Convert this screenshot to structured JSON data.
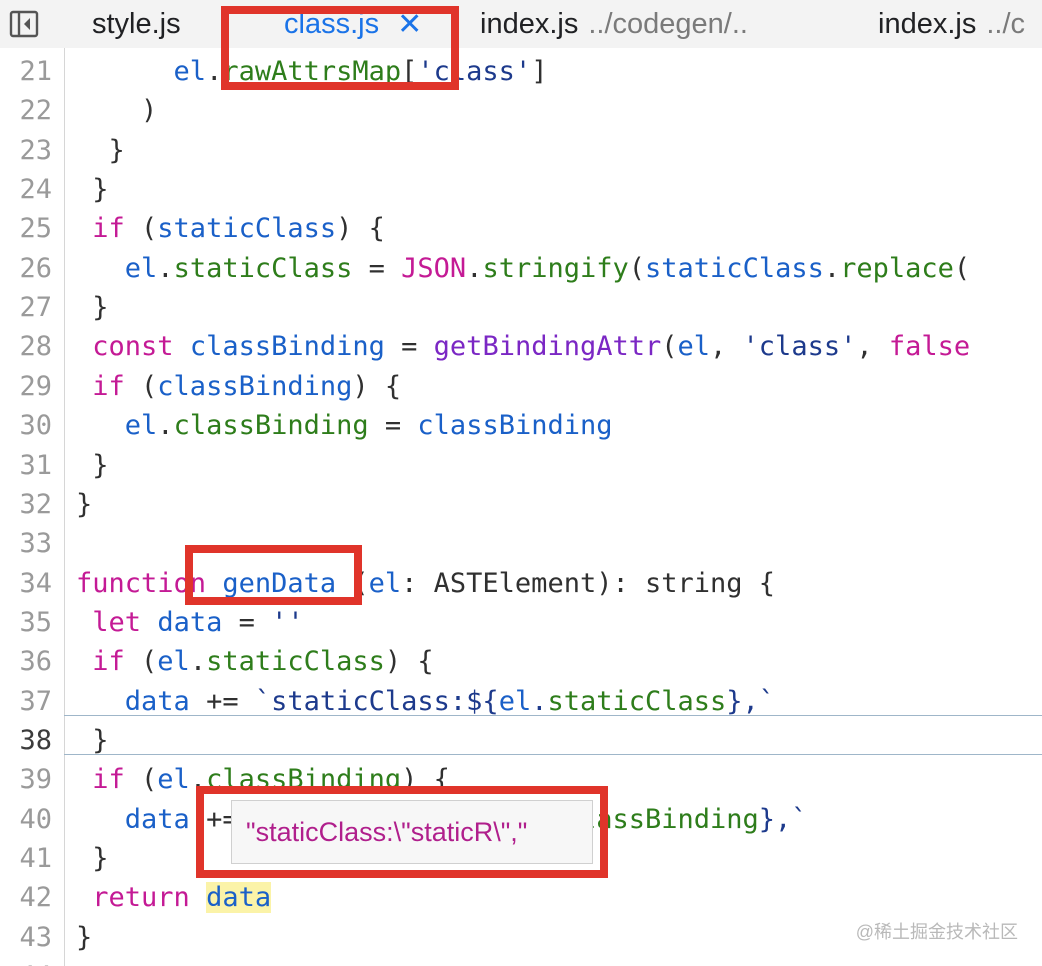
{
  "tabs": [
    {
      "name": "style.js",
      "hint": ""
    },
    {
      "name": "class.js",
      "hint": "",
      "close": "✕",
      "active": true
    },
    {
      "name": "index.js",
      "hint": "../codegen/.."
    },
    {
      "name": "index.js",
      "hint": "../c"
    }
  ],
  "lines": [
    {
      "n": "21",
      "tokens": [
        [
          "t",
          "      "
        ],
        [
          "v",
          "el"
        ],
        [
          "t",
          "."
        ],
        [
          "p",
          "rawAttrsMap"
        ],
        [
          "t",
          "["
        ],
        [
          "s",
          "'class'"
        ],
        [
          "t",
          "]"
        ]
      ]
    },
    {
      "n": "22",
      "tokens": [
        [
          "t",
          "    )"
        ]
      ]
    },
    {
      "n": "23",
      "tokens": [
        [
          "t",
          "  }"
        ]
      ]
    },
    {
      "n": "24",
      "tokens": [
        [
          "t",
          " }"
        ]
      ]
    },
    {
      "n": "25",
      "tokens": [
        [
          "t",
          " "
        ],
        [
          "k",
          "if"
        ],
        [
          "t",
          " ("
        ],
        [
          "v",
          "staticClass"
        ],
        [
          "t",
          ") {"
        ]
      ]
    },
    {
      "n": "26",
      "tokens": [
        [
          "t",
          "   "
        ],
        [
          "v",
          "el"
        ],
        [
          "t",
          "."
        ],
        [
          "p",
          "staticClass"
        ],
        [
          "t",
          " = "
        ],
        [
          "k",
          "JSON"
        ],
        [
          "t",
          "."
        ],
        [
          "p",
          "stringify"
        ],
        [
          "t",
          "("
        ],
        [
          "v",
          "staticClass"
        ],
        [
          "t",
          "."
        ],
        [
          "p",
          "replace"
        ],
        [
          "t",
          "("
        ]
      ]
    },
    {
      "n": "27",
      "tokens": [
        [
          "t",
          " }"
        ]
      ]
    },
    {
      "n": "28",
      "tokens": [
        [
          "t",
          " "
        ],
        [
          "k",
          "const"
        ],
        [
          "t",
          " "
        ],
        [
          "v",
          "classBinding"
        ],
        [
          "t",
          " = "
        ],
        [
          "f",
          "getBindingAttr"
        ],
        [
          "t",
          "("
        ],
        [
          "v",
          "el"
        ],
        [
          "t",
          ", "
        ],
        [
          "s",
          "'class'"
        ],
        [
          "t",
          ", "
        ],
        [
          "k",
          "false"
        ]
      ]
    },
    {
      "n": "29",
      "tokens": [
        [
          "t",
          " "
        ],
        [
          "k",
          "if"
        ],
        [
          "t",
          " ("
        ],
        [
          "v",
          "classBinding"
        ],
        [
          "t",
          ") {"
        ]
      ]
    },
    {
      "n": "30",
      "tokens": [
        [
          "t",
          "   "
        ],
        [
          "v",
          "el"
        ],
        [
          "t",
          "."
        ],
        [
          "p",
          "classBinding"
        ],
        [
          "t",
          " = "
        ],
        [
          "v",
          "classBinding"
        ]
      ]
    },
    {
      "n": "31",
      "tokens": [
        [
          "t",
          " }"
        ]
      ]
    },
    {
      "n": "32",
      "tokens": [
        [
          "t",
          "}"
        ]
      ]
    },
    {
      "n": "33",
      "tokens": []
    },
    {
      "n": "34",
      "tokens": [
        [
          "k",
          "function"
        ],
        [
          "t",
          " "
        ],
        [
          "v",
          "genData"
        ],
        [
          "t",
          " ("
        ],
        [
          "v",
          "el"
        ],
        [
          "t",
          ": ASTElement): string {"
        ]
      ]
    },
    {
      "n": "35",
      "tokens": [
        [
          "t",
          " "
        ],
        [
          "k",
          "let"
        ],
        [
          "t",
          " "
        ],
        [
          "v",
          "data"
        ],
        [
          "t",
          " = "
        ],
        [
          "s",
          "''"
        ]
      ]
    },
    {
      "n": "36",
      "tokens": [
        [
          "t",
          " "
        ],
        [
          "k",
          "if"
        ],
        [
          "t",
          " ("
        ],
        [
          "v",
          "el"
        ],
        [
          "t",
          "."
        ],
        [
          "p",
          "staticClass"
        ],
        [
          "t",
          ") {"
        ]
      ]
    },
    {
      "n": "37",
      "tokens": [
        [
          "t",
          "   "
        ],
        [
          "v",
          "data"
        ],
        [
          "t",
          " += "
        ],
        [
          "s",
          "`staticClass:${"
        ],
        [
          "v",
          "el"
        ],
        [
          "s",
          "."
        ],
        [
          "p",
          "staticClass"
        ],
        [
          "s",
          "},`"
        ]
      ]
    },
    {
      "n": "38",
      "tokens": [
        [
          "t",
          " }"
        ]
      ],
      "current": true
    },
    {
      "n": "39",
      "tokens": [
        [
          "t",
          " "
        ],
        [
          "k",
          "if"
        ],
        [
          "t",
          " ("
        ],
        [
          "v",
          "el"
        ],
        [
          "t",
          "."
        ],
        [
          "p",
          "classBinding"
        ],
        [
          "t",
          ") {"
        ]
      ]
    },
    {
      "n": "40",
      "tokens": [
        [
          "t",
          "   "
        ],
        [
          "v",
          "data"
        ],
        [
          "t",
          " += "
        ],
        [
          "s",
          "`classBinding:${"
        ],
        [
          "v",
          "el"
        ],
        [
          "s",
          "."
        ],
        [
          "p",
          "classBinding"
        ],
        [
          "s",
          "},`"
        ]
      ]
    },
    {
      "n": "41",
      "tokens": [
        [
          "t",
          " }"
        ]
      ]
    },
    {
      "n": "42",
      "tokens": [
        [
          "t",
          " "
        ],
        [
          "k",
          "return"
        ],
        [
          "t",
          " "
        ],
        [
          "hlv",
          "data"
        ]
      ]
    },
    {
      "n": "43",
      "tokens": [
        [
          "t",
          "}"
        ]
      ]
    },
    {
      "n": "44",
      "tokens": []
    }
  ],
  "tooltip": {
    "text": "\"staticClass:\\\"staticR\\\",\""
  },
  "watermark": "@稀土掘金技术社区",
  "colors": {
    "annotation": "#e0342a",
    "active_tab": "#1a73e8"
  }
}
